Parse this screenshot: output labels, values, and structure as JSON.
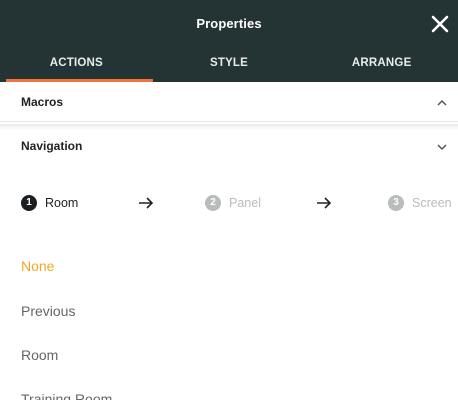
{
  "header": {
    "title": "Properties",
    "close_icon": "close-icon"
  },
  "tabs": [
    {
      "label": "ACTIONS",
      "active": true
    },
    {
      "label": "STYLE",
      "active": false
    },
    {
      "label": "ARRANGE",
      "active": false
    }
  ],
  "sections": {
    "macros": {
      "label": "Macros",
      "expanded": true
    },
    "navigation": {
      "label": "Navigation",
      "expanded": false
    }
  },
  "stepper": {
    "steps": [
      {
        "number": "1",
        "label": "Room",
        "active": true
      },
      {
        "number": "2",
        "label": "Panel",
        "active": false
      },
      {
        "number": "3",
        "label": "Screen",
        "active": false
      }
    ]
  },
  "options": [
    {
      "label": "None",
      "selected": true
    },
    {
      "label": "Previous",
      "selected": false
    },
    {
      "label": "Room",
      "selected": false
    },
    {
      "label": "Training Room",
      "selected": false
    }
  ],
  "colors": {
    "header_bg": "#243333",
    "tab_indicator": "#f2733a",
    "selected_option": "#f5a623",
    "option_text": "#666666"
  }
}
